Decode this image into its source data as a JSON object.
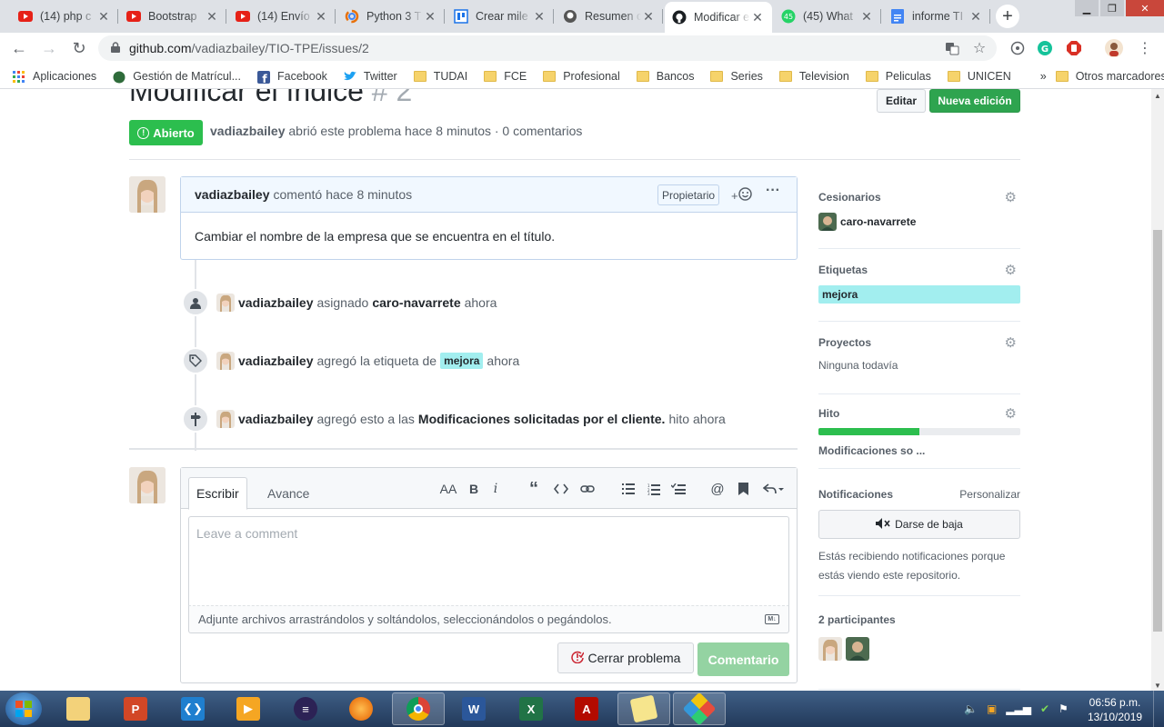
{
  "browser": {
    "tabs": [
      {
        "title": "(14) php c",
        "icon": "youtube-icon"
      },
      {
        "title": "Bootstrap",
        "icon": "youtube-icon"
      },
      {
        "title": "(14) Envío",
        "icon": "youtube-icon"
      },
      {
        "title": "Python 3 T",
        "icon": "colab-icon"
      },
      {
        "title": "Crear mile",
        "icon": "docs-icon"
      },
      {
        "title": "Resumen c",
        "icon": "github-icon"
      },
      {
        "title": "Modificar e",
        "icon": "github-icon"
      },
      {
        "title": "(45) What",
        "icon": "whatsapp-icon"
      },
      {
        "title": "informe TI",
        "icon": "google-docs-icon"
      }
    ],
    "url_host": "github.com",
    "url_path": "/vadiazbailey/TIO-TPE/issues/2",
    "bookmarks": [
      "Aplicaciones",
      "Gestión de Matrícul...",
      "Facebook",
      "Twitter",
      "TUDAI",
      "FCE",
      "Profesional",
      "Bancos",
      "Series",
      "Television",
      "Peliculas",
      "UNICEN"
    ],
    "bookmarks_more": "»",
    "other_bookmarks": "Otros marcadores"
  },
  "issue": {
    "title": "Modificar el índice",
    "number": "# 2",
    "edit_label": "Editar",
    "new_issue_label": "Nueva edición",
    "status": "Abierto",
    "author": "vadiazbailey",
    "opened_text": "abrió este problema",
    "time": "hace 8 minutos",
    "comments": "· 0 comentarios"
  },
  "comment": {
    "author": "vadiazbailey",
    "action": "comentó",
    "time": "hace 8 minutos",
    "role": "Propietario",
    "reaction_plus": "+",
    "body": "Cambiar el nombre de la empresa que se encuentra en el título."
  },
  "timeline": [
    {
      "actor": "vadiazbailey",
      "action": "asignado",
      "target": "caro-navarrete",
      "time": "ahora"
    },
    {
      "actor": "vadiazbailey",
      "action": "agregó la etiqueta de",
      "label": "mejora",
      "time": "ahora"
    },
    {
      "actor": "vadiazbailey",
      "action": "agregó esto a las",
      "target": "Modificaciones solicitadas por el cliente.",
      "suffix": "hito",
      "time": "ahora"
    }
  ],
  "editor": {
    "tab_write": "Escribir",
    "tab_preview": "Avance",
    "toolbar": [
      "AA",
      "B",
      "i"
    ],
    "placeholder": "Leave a comment",
    "attach_text": "Adjunte archivos arrastrándolos y soltándolos, seleccionándolos o pegándolos.",
    "close_label": "Cerrar problema",
    "comment_label": "Comentario"
  },
  "sidebar": {
    "assignees_title": "Cesionarios",
    "assignee": "caro-navarrete",
    "labels_title": "Etiquetas",
    "label": "mejora",
    "label_color": "#a2eeef",
    "projects_title": "Proyectos",
    "projects_value": "Ninguna todavía",
    "milestone_title": "Hito",
    "milestone_name": "Modificaciones so ...",
    "milestone_progress": 0.5,
    "notifications_title": "Notificaciones",
    "customize": "Personalizar",
    "unsubscribe": "Darse de baja",
    "notif_desc": "Estás recibiendo notificaciones porque estás viendo este repositorio.",
    "participants_title": "2 participantes"
  },
  "taskbar": {
    "clock_time": "06:56 p.m.",
    "clock_date": "13/10/2019"
  },
  "colors": {
    "open_green": "#2cbe4e",
    "primary_button": "#2ea44f",
    "label_mejora": "#a2eeef"
  }
}
